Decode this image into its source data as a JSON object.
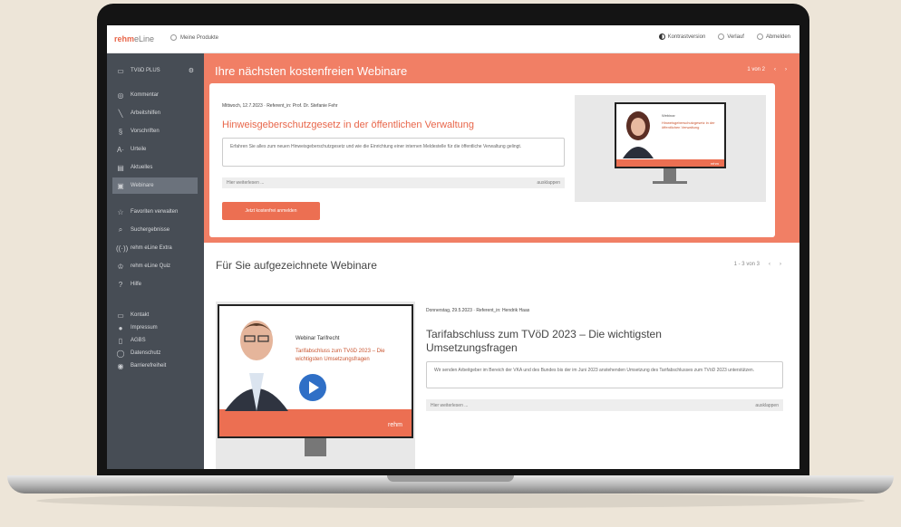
{
  "topbar": {
    "logo_main": "rehm",
    "logo_alt": "eLine",
    "product_label": "Meine Produkte",
    "contrast_label": "Kontrastversion",
    "history_label": "Verlauf",
    "logout_label": "Abmelden"
  },
  "sidebar": {
    "product": "TVöD PLUS",
    "items": [
      {
        "label": "Kommentar",
        "icon": "book-icon"
      },
      {
        "label": "Arbeitshilfen",
        "icon": "tools-icon"
      },
      {
        "label": "Vorschriften",
        "icon": "paragraph-icon"
      },
      {
        "label": "Urteile",
        "icon": "law-icon"
      },
      {
        "label": "Aktuelles",
        "icon": "news-icon"
      },
      {
        "label": "Webinare",
        "icon": "video-icon"
      },
      {
        "label": "Favoriten verwalten",
        "icon": "star-icon"
      },
      {
        "label": "Suchergebnisse",
        "icon": "search-icon"
      },
      {
        "label": "rehm eLine Extra",
        "icon": "extra-icon"
      },
      {
        "label": "rehm eLine Quiz",
        "icon": "quiz-icon"
      },
      {
        "label": "Hilfe",
        "icon": "help-icon"
      },
      {
        "label": "Kontakt",
        "icon": "contact-icon"
      },
      {
        "label": "Impressum",
        "icon": "info-icon"
      },
      {
        "label": "AGBS",
        "icon": "doc-icon"
      },
      {
        "label": "Datenschutz",
        "icon": "shield-icon"
      },
      {
        "label": "Barrierefreiheit",
        "icon": "access-icon"
      }
    ]
  },
  "hero": {
    "title": "Ihre nächsten kostenfreien Webinare",
    "pager": "1 von 2",
    "meta": "Mittwoch, 12.7.2023 · Referent_in: Prof. Dr. Stefanie Fehr",
    "card_title": "Hinweisgeberschutzgesetz in der öffentlichen Verwaltung",
    "description": "Erfahren Sie alles zum neuen Hinweisgeberschutzgesetz und wie die Einrichtung einer internen Meldestelle für die öffentliche Verwaltung gelingt.",
    "read_more": "Hier weiterlesen ...",
    "read_more_right": "ausklappen",
    "cta": "Jetzt kostenfrei anmelden",
    "thumb_heading": "Webinar",
    "thumb_title": "Hinweisgeberschutzgesetz in der öffentlichen Verwaltung",
    "thumb_brand": "rehm"
  },
  "recorded": {
    "title": "Für Sie aufgezeichnete Webinare",
    "pager": "1 - 3 von 3",
    "meta": "Donnerstag, 29.5.2023 · Referent_in: Hendrik Haas",
    "card_title": "Tarifabschluss zum TVöD 2023 – Die wichtigsten Umsetzungsfragen",
    "description": "Wir senden Arbeitgeber im Bereich der VKA und des Bundes bis der im Juni 2023 anstehenden Umsetzung des Tarifabschlusses zum TVöD 2023 unterstützen.",
    "read_more": "Hier weiterlesen ...",
    "read_more_right": "ausklappen",
    "thumb_heading": "Webinar Tarifrecht",
    "thumb_title": "Tarifabschluss zum TVöD 2023 – Die wichtigsten Umsetzungsfragen",
    "thumb_brand": "rehm"
  },
  "colors": {
    "accent": "#f17f65",
    "sidebar": "#474d55",
    "play": "#2f6fc6"
  }
}
